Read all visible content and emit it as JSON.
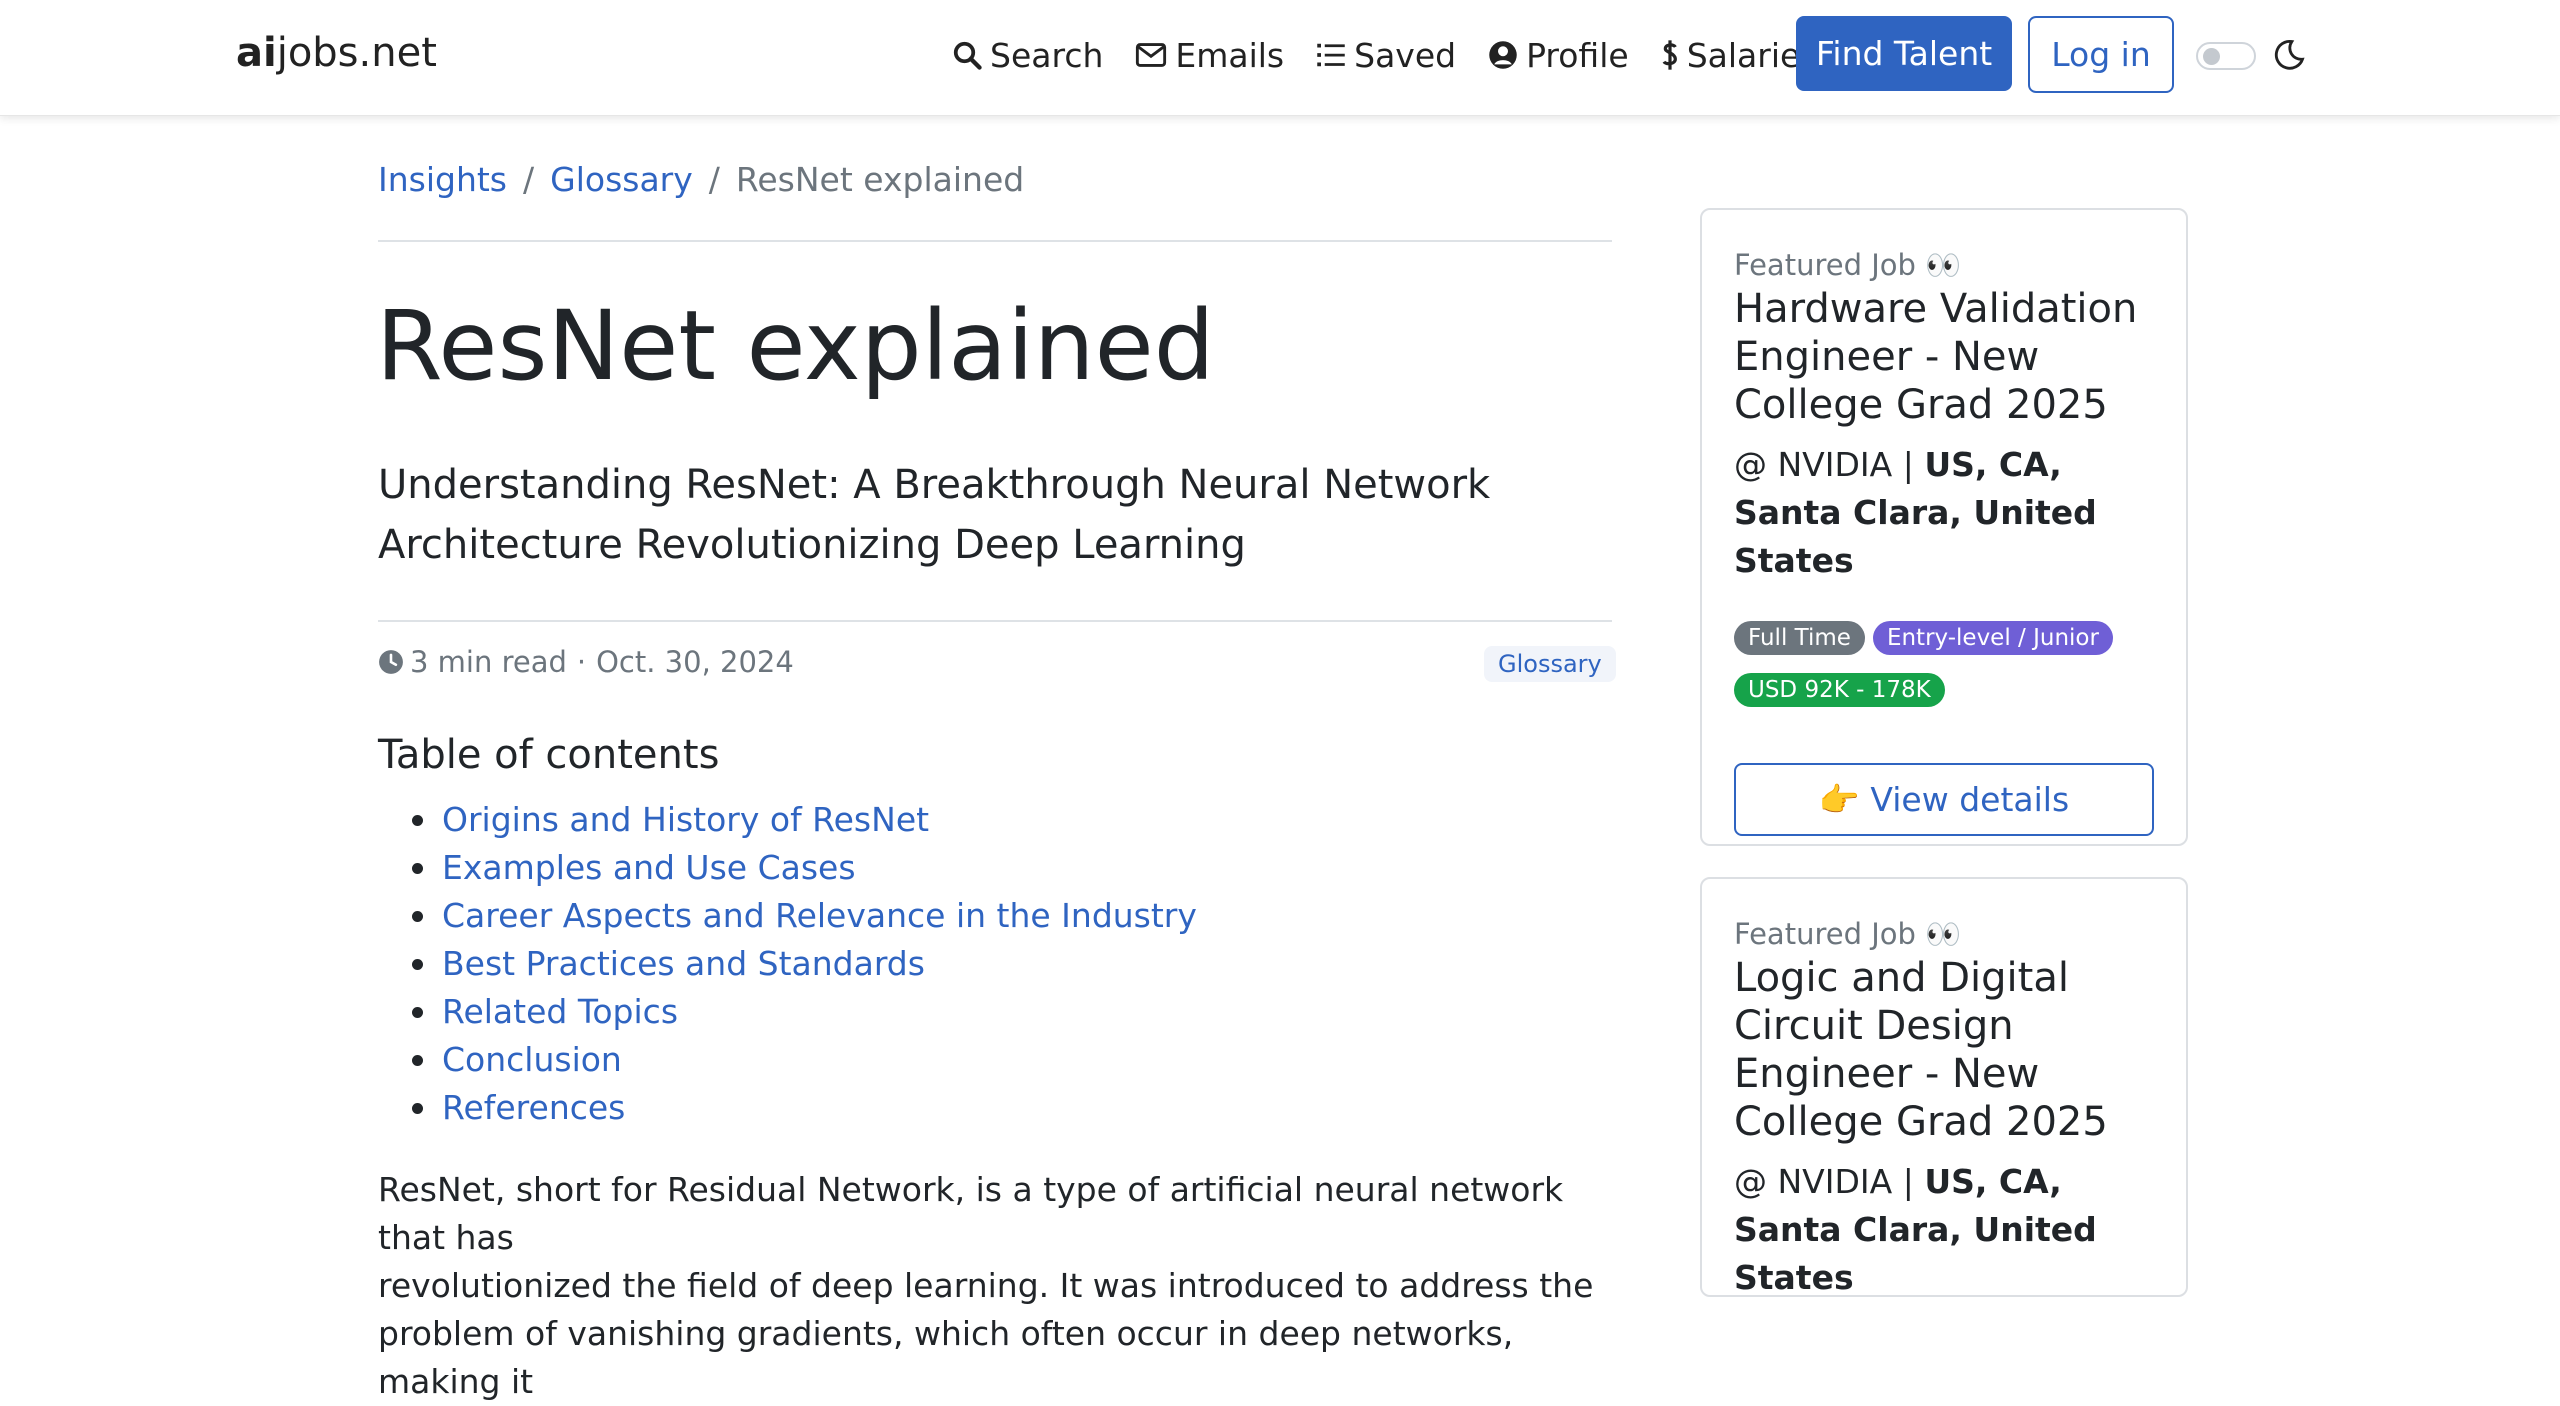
{
  "nav": {
    "brand_bold": "ai",
    "brand_rest": "jobs.net",
    "links": [
      {
        "label": "Search",
        "icon": "search-icon"
      },
      {
        "label": "Emails",
        "icon": "envelope-icon"
      },
      {
        "label": "Saved",
        "icon": "list-icon"
      },
      {
        "label": "Profile",
        "icon": "user-circle-icon"
      },
      {
        "label": "Salaries",
        "icon": "dollar-icon"
      }
    ],
    "find_talent": "Find Talent",
    "login": "Log in",
    "theme_icon": "moon-icon"
  },
  "breadcrumb": {
    "items": [
      "Insights",
      "Glossary"
    ],
    "current": "ResNet explained",
    "separator": "/"
  },
  "article": {
    "title": "ResNet explained",
    "lead": "Understanding ResNet: A Breakthrough Neural Network Architecture Revolutionizing Deep Learning",
    "read_time": "3 min read",
    "dot": "·",
    "date": "Oct. 30, 2024",
    "category": "Glossary",
    "toc_heading": "Table of contents",
    "toc": [
      "Origins and History of ResNet",
      "Examples and Use Cases",
      "Career Aspects and Relevance in the Industry",
      "Best Practices and Standards",
      "Related Topics",
      "Conclusion",
      "References"
    ],
    "intro_line1": "ResNet, short for Residual Network, is a type of artificial neural network that has",
    "intro_line2": "revolutionized the field of deep learning. It was introduced to address the",
    "intro_line3": "problem of vanishing gradients, which often occur in deep networks, making it"
  },
  "featured_jobs": [
    {
      "label": "Featured Job 👀",
      "title": "Hardware Validation Engineer - New College Grad 2025",
      "company_prefix": "@ NVIDIA |",
      "location": "US, CA, Santa Clara, United States",
      "tags": [
        "Full Time",
        "Entry-level / Junior",
        "USD 92K - 178K"
      ],
      "button": "👉 View details"
    },
    {
      "label": "Featured Job 👀",
      "title": "Logic and Digital Circuit Design Engineer - New College Grad 2025",
      "company_prefix": "@ NVIDIA |",
      "location": "US, CA, Santa Clara, United States"
    }
  ],
  "colors": {
    "primary": "#2f64c1",
    "tag_full_time": "#6c757d",
    "tag_level": "#6f5fd6",
    "tag_salary": "#16a34a"
  }
}
